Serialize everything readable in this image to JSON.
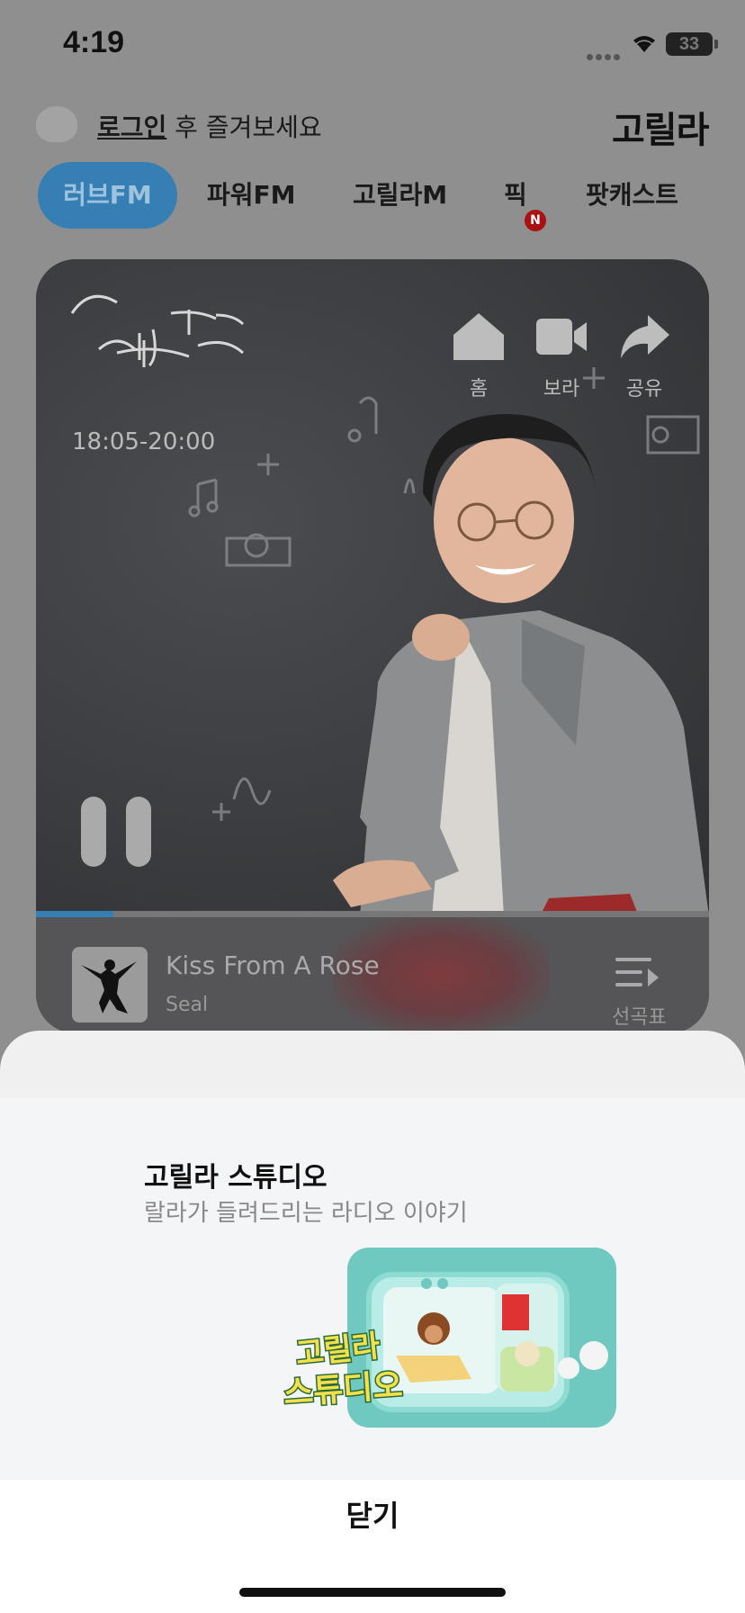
{
  "status_bar": {
    "time": "4:19",
    "battery": "33"
  },
  "header": {
    "login_link": "로그인",
    "login_suffix": " 후 즐겨보세요",
    "brand": "고릴라"
  },
  "tabs": [
    {
      "label": "러브FM",
      "active": true
    },
    {
      "label": "파워FM",
      "active": false
    },
    {
      "label": "고릴라M",
      "active": false
    },
    {
      "label": "픽",
      "active": false,
      "badge": "N"
    },
    {
      "label": "팟캐스트",
      "active": false
    }
  ],
  "player": {
    "show_title_art": "에, 저녁바람 김창완입니다.",
    "show_time": "18:05-20:00",
    "actions": {
      "home": "홈",
      "watch": "보라",
      "share": "공유"
    },
    "progress_percent": 11.5,
    "now_playing": {
      "title": "Kiss From A Rose",
      "artist": "Seal",
      "playlist_label": "선곡표"
    }
  },
  "sheet": {
    "title": "고릴라 스튜디오",
    "subtitle": "랄라가 들려드리는 라디오 이야기",
    "banner_text_line1": "고릴라",
    "banner_text_line2": "스튜디오",
    "close_label": "닫기"
  },
  "colors": {
    "accent": "#357fb5",
    "badge": "#aa1111"
  }
}
